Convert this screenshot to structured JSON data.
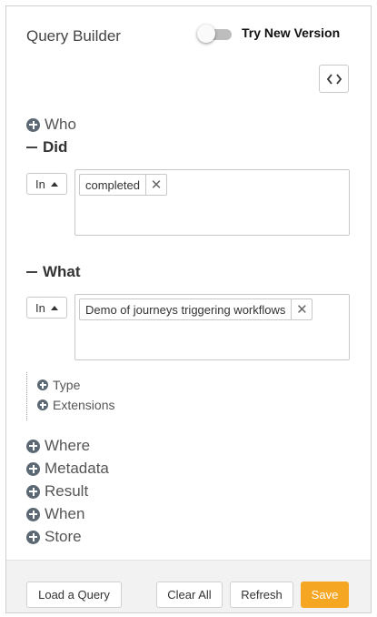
{
  "header": {
    "title": "Query Builder",
    "toggle_label": "Try New Version"
  },
  "code_button": {
    "icon": "code-icon",
    "glyph": "<>"
  },
  "collapsed_top": {
    "label": "Who"
  },
  "did": {
    "label": "Did",
    "operator": "In",
    "tags": [
      "completed"
    ]
  },
  "what": {
    "label": "What",
    "operator": "In",
    "tags": [
      "Demo of journeys triggering workflows"
    ],
    "sub_items": [
      "Type",
      "Extensions"
    ]
  },
  "collapsed_bottom": [
    "Where",
    "Metadata",
    "Result",
    "When",
    "Store"
  ],
  "footer": {
    "load_label": "Load a Query",
    "clear_label": "Clear All",
    "refresh_label": "Refresh",
    "save_label": "Save"
  },
  "colors": {
    "accent": "#f5a623",
    "icon": "#5c6873"
  }
}
